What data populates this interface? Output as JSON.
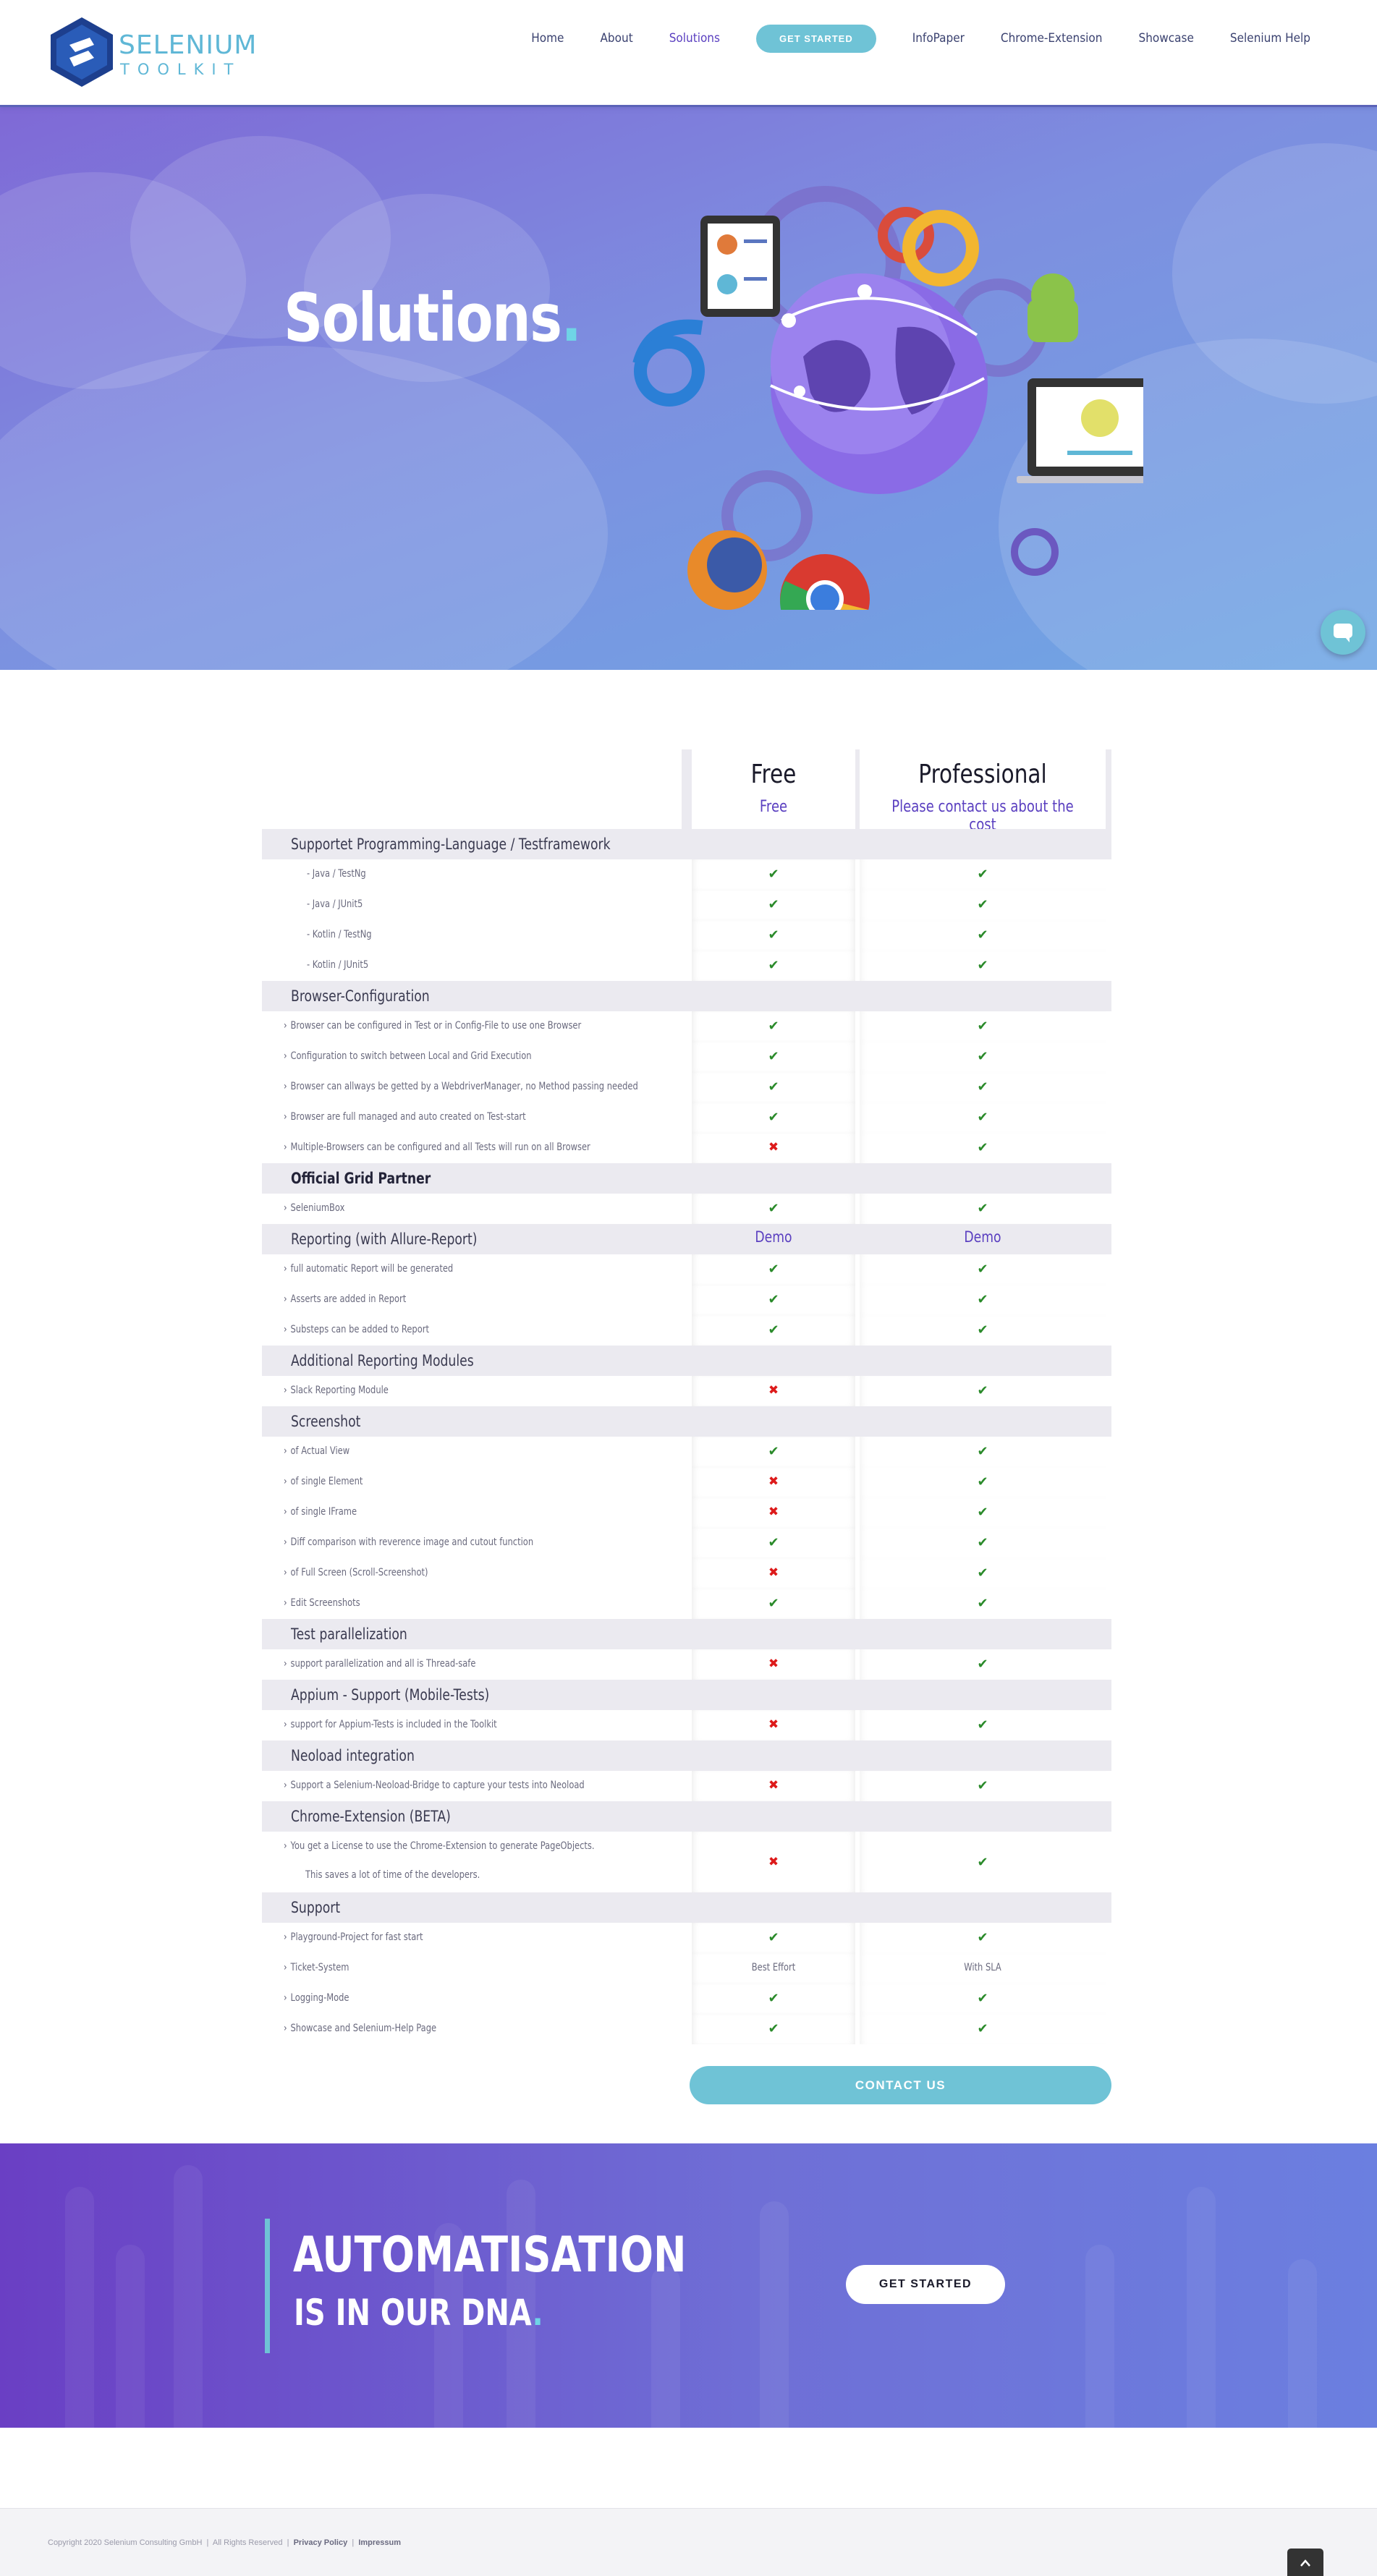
{
  "header": {
    "logo_title": "SELENIUM",
    "logo_subtitle": "TOOLKIT",
    "nav": {
      "home": "Home",
      "about": "About",
      "solutions": "Solutions",
      "get_started": "GET STARTED",
      "infopaper": "InfoPaper",
      "chrome_extension": "Chrome-Extension",
      "showcase": "Showcase",
      "selenium_help": "Selenium Help"
    }
  },
  "hero": {
    "title": "Solutions",
    "title_dot": "."
  },
  "pricing": {
    "free": {
      "title": "Free",
      "price": "Free"
    },
    "pro": {
      "title": "Professional",
      "price": "Please contact us about the cost"
    },
    "rows": [
      {
        "type": "cat",
        "label": "Supportet Programming-Language / Testframework"
      },
      {
        "type": "sub",
        "label": "- Java / TestNg",
        "free": "yes",
        "pro": "yes"
      },
      {
        "type": "sub",
        "label": "- Java / JUnit5",
        "free": "yes",
        "pro": "yes"
      },
      {
        "type": "sub",
        "label": "- Kotlin / TestNg",
        "free": "yes",
        "pro": "yes"
      },
      {
        "type": "sub",
        "label": "- Kotlin / JUnit5",
        "free": "yes",
        "pro": "yes"
      },
      {
        "type": "cat",
        "label": "Browser-Configuration"
      },
      {
        "type": "item",
        "label": "Browser can be configured in Test or in Config-File to use one Browser",
        "free": "yes",
        "pro": "yes"
      },
      {
        "type": "item",
        "label": "Configuration to switch between Local and Grid Execution",
        "free": "yes",
        "pro": "yes"
      },
      {
        "type": "item",
        "label": "Browser can allways be getted by a WebdriverManager, no Method passing needed",
        "free": "yes",
        "pro": "yes"
      },
      {
        "type": "item",
        "label": "Browser are full managed and auto created on Test-start",
        "free": "yes",
        "pro": "yes"
      },
      {
        "type": "item",
        "label": "Multiple-Browsers can be configured and all Tests will run on all Browser",
        "free": "no",
        "pro": "yes"
      },
      {
        "type": "cat",
        "label": "Official Grid Partner",
        "strong": true
      },
      {
        "type": "item",
        "label": "SeleniumBox",
        "free": "yes",
        "pro": "yes"
      },
      {
        "type": "cat",
        "label": "Reporting (with Allure-Report)",
        "free_text": "Demo",
        "pro_text": "Demo"
      },
      {
        "type": "item",
        "label": "full automatic Report will be generated",
        "free": "yes",
        "pro": "yes"
      },
      {
        "type": "item",
        "label": "Asserts are added in Report",
        "free": "yes",
        "pro": "yes"
      },
      {
        "type": "item",
        "label": "Substeps can be added to Report",
        "free": "yes",
        "pro": "yes"
      },
      {
        "type": "cat",
        "label": "Additional Reporting Modules"
      },
      {
        "type": "item",
        "label": "Slack Reporting Module",
        "free": "no",
        "pro": "yes"
      },
      {
        "type": "cat",
        "label": "Screenshot"
      },
      {
        "type": "item",
        "label": "of Actual View",
        "free": "yes",
        "pro": "yes"
      },
      {
        "type": "item",
        "label": "of single Element",
        "free": "no",
        "pro": "yes"
      },
      {
        "type": "item",
        "label": "of single IFrame",
        "free": "no",
        "pro": "yes"
      },
      {
        "type": "item",
        "label": "Diff comparison with reverence image and cutout function",
        "free": "yes",
        "pro": "yes"
      },
      {
        "type": "item",
        "label": "of Full Screen (Scroll-Screenshot)",
        "free": "no",
        "pro": "yes"
      },
      {
        "type": "item",
        "label": "Edit Screenshots",
        "free": "yes",
        "pro": "yes"
      },
      {
        "type": "cat",
        "label": "Test parallelization"
      },
      {
        "type": "item",
        "label": "support parallelization and all is Thread-safe",
        "free": "no",
        "pro": "yes"
      },
      {
        "type": "cat",
        "label": "Appium - Support (Mobile-Tests)"
      },
      {
        "type": "item",
        "label": "support for Appium-Tests is included in the Toolkit",
        "free": "no",
        "pro": "yes"
      },
      {
        "type": "cat",
        "label": "Neoload integration"
      },
      {
        "type": "item",
        "label": "Support a Selenium-Neoload-Bridge to capture your tests into Neoload",
        "free": "no",
        "pro": "yes"
      },
      {
        "type": "cat",
        "label": "Chrome-Extension (BETA)"
      },
      {
        "type": "tall",
        "label": "You get a License to use the Chrome-Extension to generate PageObjects.",
        "label2": "This saves a lot of time of the developers.",
        "free": "no",
        "pro": "yes"
      },
      {
        "type": "cat",
        "label": "Support"
      },
      {
        "type": "item",
        "label": "Playground-Project for fast start",
        "free": "yes",
        "pro": "yes"
      },
      {
        "type": "item",
        "label": "Ticket-System",
        "free_text": "Best Effort",
        "pro_text": "With SLA"
      },
      {
        "type": "item",
        "label": "Logging-Mode",
        "free": "yes",
        "pro": "yes"
      },
      {
        "type": "item",
        "label": "Showcase and Selenium-Help Page",
        "free": "yes",
        "pro": "yes"
      }
    ],
    "contact_label": "CONTACT US"
  },
  "banner": {
    "line1": "AUTOMATISATION",
    "line2": "IS IN OUR DNA",
    "line2_dot": ".",
    "button": "GET STARTED"
  },
  "footer": {
    "copyright": "Copyright 2020 Selenium Consulting GmbH",
    "sep1": "|",
    "rights": "All Rights Reserved",
    "sep2": "|",
    "privacy": "Privacy Policy",
    "sep3": "|",
    "impressum": "Impressum"
  },
  "colors": {
    "accent": "#6fc3d6",
    "purple": "#5a3fc0",
    "check": "#2a8a2a",
    "cross": "#dd1a1a"
  },
  "icons": {
    "check": "check-icon",
    "cross": "cross-icon",
    "chevron": "chevron-right-icon",
    "chat": "chat-icon",
    "to_top": "chevron-up-icon"
  }
}
